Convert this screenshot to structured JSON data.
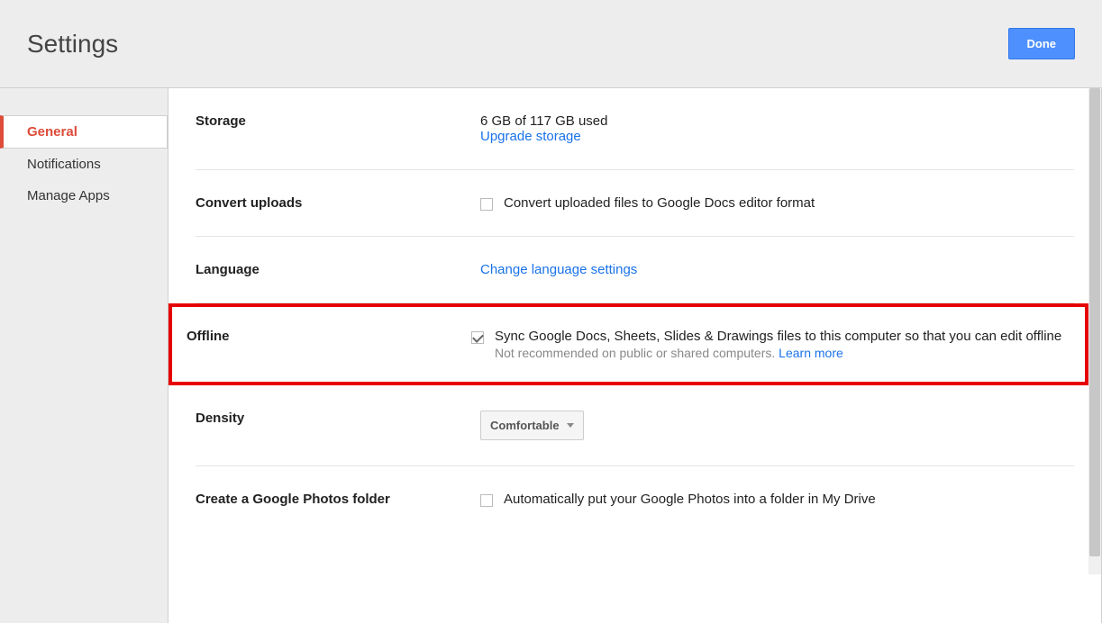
{
  "header": {
    "title": "Settings",
    "done": "Done"
  },
  "sidebar": {
    "items": [
      {
        "label": "General",
        "active": true
      },
      {
        "label": "Notifications",
        "active": false
      },
      {
        "label": "Manage Apps",
        "active": false
      }
    ]
  },
  "rows": {
    "storage": {
      "label": "Storage",
      "status": "6 GB of 117 GB used",
      "link": "Upgrade storage"
    },
    "convert": {
      "label": "Convert uploads",
      "checked": false,
      "text": "Convert uploaded files to Google Docs editor format"
    },
    "language": {
      "label": "Language",
      "link": "Change language settings"
    },
    "offline": {
      "label": "Offline",
      "checked": true,
      "text": "Sync Google Docs, Sheets, Slides & Drawings files to this computer so that you can edit offline",
      "note": "Not recommended on public or shared computers. ",
      "learn": "Learn more"
    },
    "density": {
      "label": "Density",
      "value": "Comfortable"
    },
    "photos": {
      "label": "Create a Google Photos folder",
      "checked": false,
      "text": "Automatically put your Google Photos into a folder in My Drive"
    }
  }
}
